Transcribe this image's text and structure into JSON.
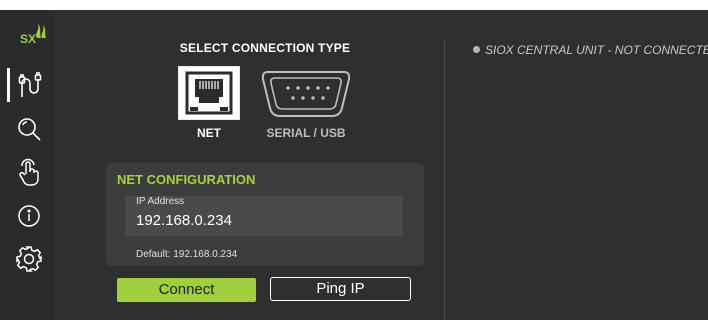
{
  "app": {
    "logo_text": "SX",
    "accent_color": "#9fd03b"
  },
  "sidebar": {
    "items": [
      {
        "name": "connection",
        "icon": "cable-plug-icon",
        "active": true
      },
      {
        "name": "search",
        "icon": "search-icon",
        "active": false
      },
      {
        "name": "touch",
        "icon": "touch-hand-icon",
        "active": false
      },
      {
        "name": "info",
        "icon": "info-icon",
        "active": false
      },
      {
        "name": "settings",
        "icon": "gear-icon",
        "active": false
      }
    ]
  },
  "connection": {
    "title": "SELECT CONNECTION TYPE",
    "types": [
      {
        "label": "NET",
        "icon": "ethernet-port-icon",
        "selected": true
      },
      {
        "label": "SERIAL / USB",
        "icon": "serial-port-icon",
        "selected": false
      }
    ]
  },
  "net_config": {
    "title": "NET CONFIGURATION",
    "ip_label": "IP Address",
    "ip_value": "192.168.0.234",
    "default_text": "Default: 192.168.0.234"
  },
  "buttons": {
    "connect": "Connect",
    "ping": "Ping IP"
  },
  "status": {
    "text": "SIOX CENTRAL UNIT - NOT CONNECTED",
    "dot_color": "#b8b8b8"
  }
}
